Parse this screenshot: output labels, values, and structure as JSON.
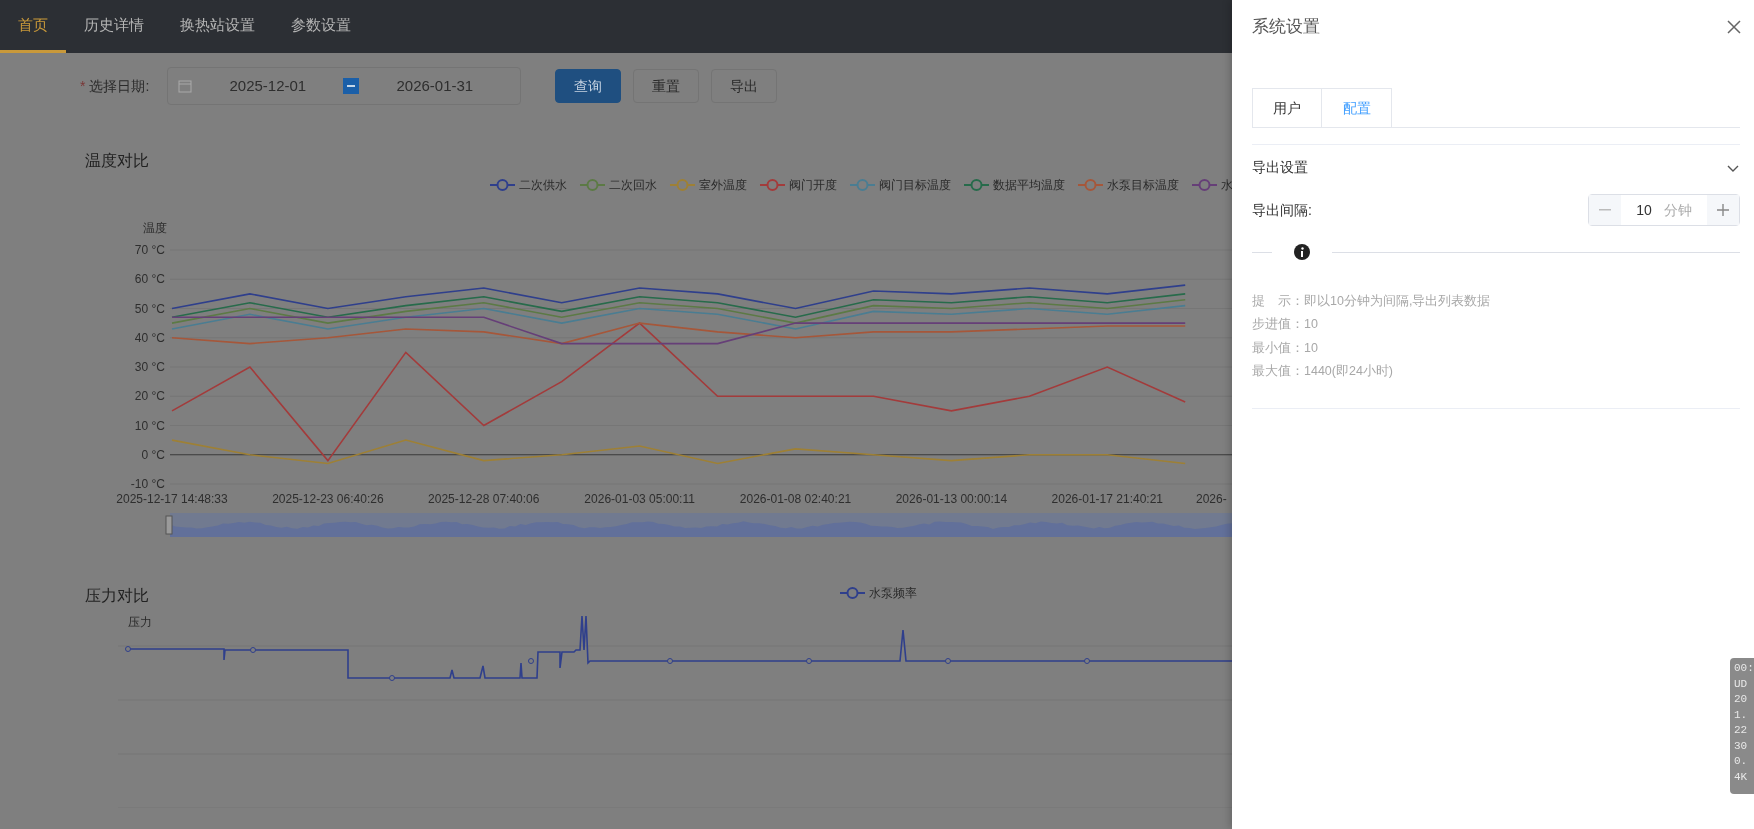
{
  "nav": {
    "tabs": [
      {
        "label": "首页",
        "selected": true
      },
      {
        "label": "历史详情",
        "selected": false
      },
      {
        "label": "换热站设置",
        "selected": false
      },
      {
        "label": "参数设置",
        "selected": false
      }
    ]
  },
  "filter": {
    "label": "选择日期:",
    "required_mark": "*",
    "start": "2025-12-01",
    "end": "2026-01-31",
    "buttons": [
      {
        "label": "查询",
        "kind": "primary"
      },
      {
        "label": "重置",
        "kind": "default"
      },
      {
        "label": "导出",
        "kind": "default"
      }
    ]
  },
  "temperature_chart": {
    "title": "温度对比",
    "chart_data": {
      "type": "line",
      "ylabel": "温度",
      "categories": [
        "2025-12-17 14:48:33",
        null,
        "2025-12-23 06:40:26",
        null,
        "2025-12-28 07:40:06",
        null,
        "2026-01-03 05:00:11",
        null,
        "2026-01-08 02:40:21",
        null,
        "2026-01-13 00:00:14",
        null,
        "2026-01-17 21:40:21",
        null
      ],
      "ylim": [
        -10,
        70
      ],
      "grid": true,
      "yticks": [
        {
          "value": 70,
          "label": "70 °C"
        },
        {
          "value": 60,
          "label": "60 °C"
        },
        {
          "value": 50,
          "label": "50 °C"
        },
        {
          "value": 40,
          "label": "40 °C"
        },
        {
          "value": 30,
          "label": "30 °C"
        },
        {
          "value": 20,
          "label": "20 °C"
        },
        {
          "value": 10,
          "label": "10 °C"
        },
        {
          "value": 0,
          "label": "0 °C"
        },
        {
          "value": -10,
          "label": "-10 °C"
        }
      ],
      "series": [
        {
          "name": "二次供水",
          "color": "#2f3f8c",
          "values": [
            50,
            55,
            50,
            54,
            57,
            52,
            57,
            55,
            50,
            56,
            55,
            57,
            55,
            58
          ]
        },
        {
          "name": "二次回水",
          "color": "#5c7a45",
          "values": [
            45,
            50,
            45,
            49,
            52,
            47,
            52,
            50,
            45,
            51,
            50,
            52,
            50,
            53
          ]
        },
        {
          "name": "室外温度",
          "color": "#9e8035",
          "values": [
            5,
            0,
            -3,
            5,
            -2,
            0,
            3,
            -3,
            2,
            0,
            -2,
            0,
            0,
            -3
          ]
        },
        {
          "name": "阀门开度",
          "color": "#a33b3b",
          "values": [
            15,
            30,
            -2,
            35,
            10,
            25,
            45,
            20,
            20,
            20,
            15,
            20,
            30,
            18
          ]
        },
        {
          "name": "阀门目标温度",
          "color": "#4a7d92",
          "values": [
            43,
            48,
            43,
            47,
            50,
            45,
            50,
            48,
            43,
            49,
            48,
            50,
            48,
            51
          ]
        },
        {
          "name": "数据平均温度",
          "color": "#276b4b",
          "values": [
            47,
            52,
            47,
            51,
            54,
            49,
            54,
            52,
            47,
            53,
            52,
            54,
            52,
            55
          ]
        },
        {
          "name": "水泵目标温度",
          "color": "#a6573a",
          "values": [
            40,
            38,
            40,
            43,
            42,
            38,
            45,
            42,
            40,
            42,
            42,
            43,
            44,
            44
          ]
        },
        {
          "name": "水",
          "color": "#663f78",
          "values": [
            47,
            47,
            47,
            47,
            47,
            38,
            38,
            38,
            45,
            45,
            45,
            45,
            45,
            45
          ]
        }
      ]
    },
    "cut_axis_label": "2026-"
  },
  "pressure_chart": {
    "title": "压力对比",
    "ylabel": "压力",
    "legend": [
      {
        "name": "水泵频率",
        "color": "#2f3f8c"
      }
    ]
  },
  "drawer": {
    "title": "系统设置",
    "tabs": [
      {
        "label": "用户",
        "selected": false
      },
      {
        "label": "配置",
        "selected": true
      }
    ],
    "section": {
      "title": "导出设置",
      "expanded": true,
      "field": {
        "label": "导出间隔:",
        "value": "10",
        "unit": "分钟"
      },
      "hints": [
        "提　示：即以10分钟为间隔,导出列表数据",
        "步进值：10",
        "最小值：10",
        "最大值：1440(即24小时)"
      ]
    }
  },
  "overlay_panel": {
    "lines": [
      "00:",
      "UD",
      "20",
      "1.",
      "22",
      "30",
      "0.",
      "4K"
    ]
  }
}
